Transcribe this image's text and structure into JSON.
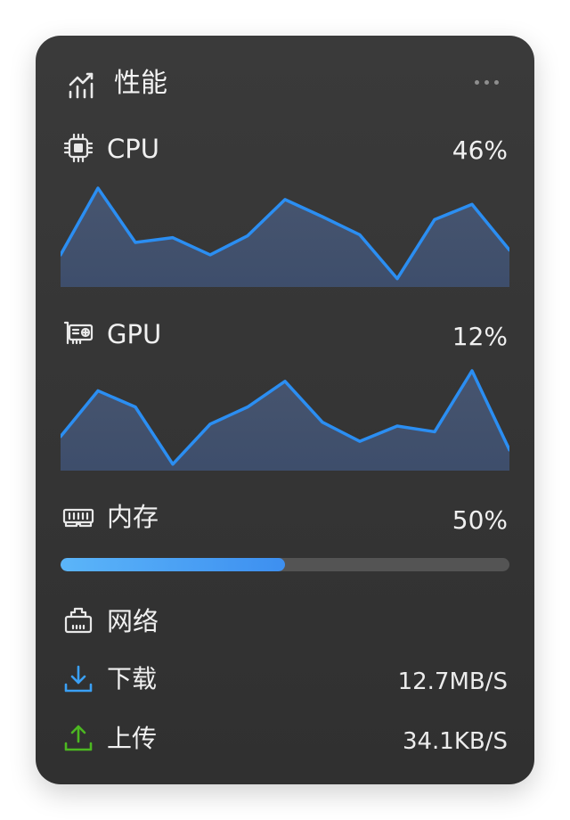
{
  "header": {
    "title": "性能",
    "icon": "line-chart-icon",
    "more_icon": "more-horizontal-icon"
  },
  "cpu": {
    "label": "CPU",
    "value": "46%",
    "icon": "cpu-chip-icon",
    "history": [
      30,
      100,
      43,
      48,
      30,
      50,
      88,
      70,
      51,
      5,
      67,
      83,
      35
    ]
  },
  "gpu": {
    "label": "GPU",
    "value": "12%",
    "icon": "graphics-card-icon",
    "history": [
      32,
      80,
      63,
      3,
      45,
      63,
      90,
      47,
      27,
      43,
      37,
      101,
      18
    ]
  },
  "memory": {
    "label": "内存",
    "value": "50%",
    "icon": "memory-ram-icon",
    "usage": 0.5
  },
  "network": {
    "label": "网络",
    "icon": "network-port-icon",
    "download": {
      "label": "下载",
      "value": "12.7MB/S",
      "icon": "download-icon"
    },
    "upload": {
      "label": "上传",
      "value": "34.1KB/S",
      "icon": "upload-icon"
    }
  },
  "colors": {
    "line": "#2b8ef2",
    "download_icon": "#3aa0f5",
    "upload_icon": "#4cb821",
    "progress_start": "#5bb5f9",
    "progress_end": "#3d8ff0"
  }
}
